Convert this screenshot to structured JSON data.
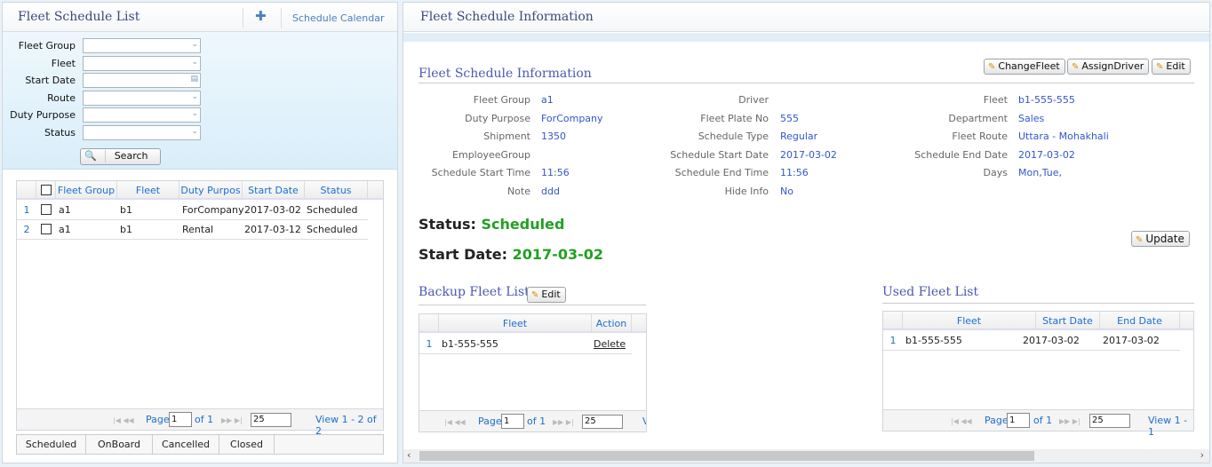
{
  "left": {
    "title": "Fleet Schedule List",
    "add_icon": "plus-icon",
    "calendar_link": "Schedule Calendar",
    "filters": [
      {
        "label": "Fleet Group",
        "value": "",
        "type": "select"
      },
      {
        "label": "Fleet",
        "value": "",
        "type": "select"
      },
      {
        "label": "Start Date",
        "value": "",
        "type": "date"
      },
      {
        "label": "Route",
        "value": "",
        "type": "select"
      },
      {
        "label": "Duty Purpose",
        "value": "",
        "type": "select"
      },
      {
        "label": "Status",
        "value": "",
        "type": "select"
      }
    ],
    "search_label": "Search",
    "grid": {
      "columns": [
        "Fleet Group",
        "Fleet",
        "Duty Purpos",
        "Start Date",
        "Status"
      ],
      "rows": [
        {
          "n": "1",
          "cells": [
            "a1",
            "b1",
            "ForCompany",
            "2017-03-02",
            "Scheduled"
          ]
        },
        {
          "n": "2",
          "cells": [
            "a1",
            "b1",
            "Rental",
            "2017-03-12",
            "Scheduled"
          ]
        }
      ],
      "pager": {
        "page_label": "Page",
        "page": "1",
        "of": "of 1",
        "page_size": "25",
        "view": "View 1 - 2 of 2"
      }
    },
    "tabs": [
      "Scheduled",
      "OnBoard",
      "Cancelled",
      "Closed"
    ]
  },
  "right": {
    "title": "Fleet Schedule Information",
    "section_title": "Fleet Schedule Information",
    "buttons": {
      "change_fleet": "ChangeFleet",
      "assign_driver": "AssignDriver",
      "edit": "Edit",
      "update": "Update"
    },
    "fields": [
      [
        {
          "label": "Fleet Group",
          "value": "a1"
        },
        {
          "label": "Driver",
          "value": ""
        },
        {
          "label": "Fleet",
          "value": "b1-555-555"
        }
      ],
      [
        {
          "label": "Duty Purpose",
          "value": "ForCompany"
        },
        {
          "label": "Fleet Plate No",
          "value": "555"
        },
        {
          "label": "Department",
          "value": "Sales"
        }
      ],
      [
        {
          "label": "Shipment",
          "value": "1350"
        },
        {
          "label": "Schedule Type",
          "value": "Regular"
        },
        {
          "label": "Fleet Route",
          "value": "Uttara - Mohakhali"
        }
      ],
      [
        {
          "label": "EmployeeGroup",
          "value": ""
        },
        {
          "label": "Schedule Start Date",
          "value": "2017-03-02"
        },
        {
          "label": "Schedule End Date",
          "value": "2017-03-02"
        }
      ],
      [
        {
          "label": "Schedule Start Time",
          "value": "11:56"
        },
        {
          "label": "Schedule End Time",
          "value": "11:56"
        },
        {
          "label": "Days",
          "value": "Mon,Tue,"
        }
      ],
      [
        {
          "label": "Note",
          "value": "ddd"
        },
        {
          "label": "Hide Info",
          "value": "No"
        }
      ]
    ],
    "status": {
      "label": "Status:",
      "value": "Scheduled"
    },
    "start_date": {
      "label": "Start Date:",
      "value": "2017-03-02"
    },
    "status_color": "#22a022",
    "backup": {
      "title": "Backup Fleet List",
      "edit": "Edit",
      "columns": [
        "Fleet",
        "Action"
      ],
      "rows": [
        {
          "n": "1",
          "fleet": "b1-555-555",
          "action": "Delete"
        }
      ],
      "pager": {
        "page_label": "Page",
        "page": "1",
        "of": "of 1",
        "page_size": "25",
        "view": "V"
      }
    },
    "used": {
      "title": "Used Fleet List",
      "columns": [
        "Fleet",
        "Start Date",
        "End Date"
      ],
      "rows": [
        {
          "n": "1",
          "cells": [
            "b1-555-555",
            "2017-03-02",
            "2017-03-02"
          ]
        }
      ],
      "pager": {
        "page_label": "Page",
        "page": "1",
        "of": "of 1",
        "page_size": "25",
        "view": "View 1 - 1"
      }
    }
  }
}
